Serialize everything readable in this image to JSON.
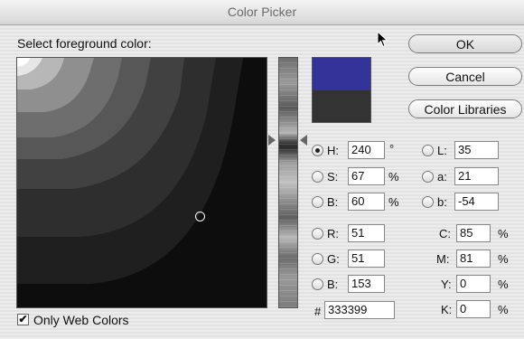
{
  "window": {
    "title": "Color Picker"
  },
  "prompt": "Select foreground color:",
  "buttons": {
    "ok": "OK",
    "cancel": "Cancel",
    "libraries": "Color Libraries"
  },
  "colors": {
    "new_swatch": "#333399",
    "current_swatch": "#333333",
    "field_base": "#0d0d0d"
  },
  "hsb": {
    "h": {
      "label": "H:",
      "value": "240",
      "unit": "°",
      "selected": true
    },
    "s": {
      "label": "S:",
      "value": "67",
      "unit": "%"
    },
    "b": {
      "label": "B:",
      "value": "60",
      "unit": "%"
    }
  },
  "rgb": {
    "r": {
      "label": "R:",
      "value": "51"
    },
    "g": {
      "label": "G:",
      "value": "51"
    },
    "b": {
      "label": "B:",
      "value": "153"
    }
  },
  "lab": {
    "l": {
      "label": "L:",
      "value": "35"
    },
    "a": {
      "label": "a:",
      "value": "21"
    },
    "b": {
      "label": "b:",
      "value": "-54"
    }
  },
  "cmyk": {
    "c": {
      "label": "C:",
      "value": "85",
      "unit": "%"
    },
    "m": {
      "label": "M:",
      "value": "81",
      "unit": "%"
    },
    "y": {
      "label": "Y:",
      "value": "0",
      "unit": "%"
    },
    "k": {
      "label": "K:",
      "value": "0",
      "unit": "%"
    }
  },
  "hex": {
    "label": "#",
    "value": "333399"
  },
  "web_only": {
    "label": "Only Web Colors",
    "checked": true,
    "mark": "✔"
  }
}
